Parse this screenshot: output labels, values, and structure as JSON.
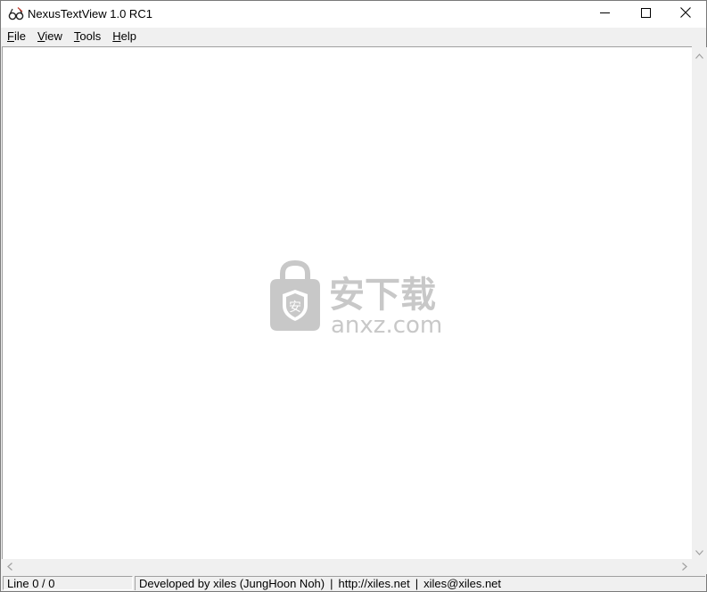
{
  "window": {
    "title": "NexusTextView 1.0 RC1",
    "icon": "glasses-app-icon",
    "controls": {
      "minimize": "minimize-icon",
      "maximize": "maximize-icon",
      "close": "close-icon"
    }
  },
  "menu": {
    "items": [
      {
        "acc": "F",
        "rest": "ile"
      },
      {
        "acc": "V",
        "rest": "iew"
      },
      {
        "acc": "T",
        "rest": "ools"
      },
      {
        "acc": "H",
        "rest": "elp"
      }
    ]
  },
  "editor": {
    "content": "",
    "watermark": {
      "cn_text": "安下载",
      "domain_text": "anxz.com"
    }
  },
  "statusbar": {
    "line_info": "Line 0 / 0",
    "developer": "Developed by xiles (JungHoon Noh)",
    "separator": "|",
    "url": "http://xiles.net",
    "email": "xiles@xiles.net"
  },
  "colors": {
    "chrome": "#f0f0f0",
    "editor_bg": "#ffffff",
    "watermark": "#c8c8c8"
  }
}
